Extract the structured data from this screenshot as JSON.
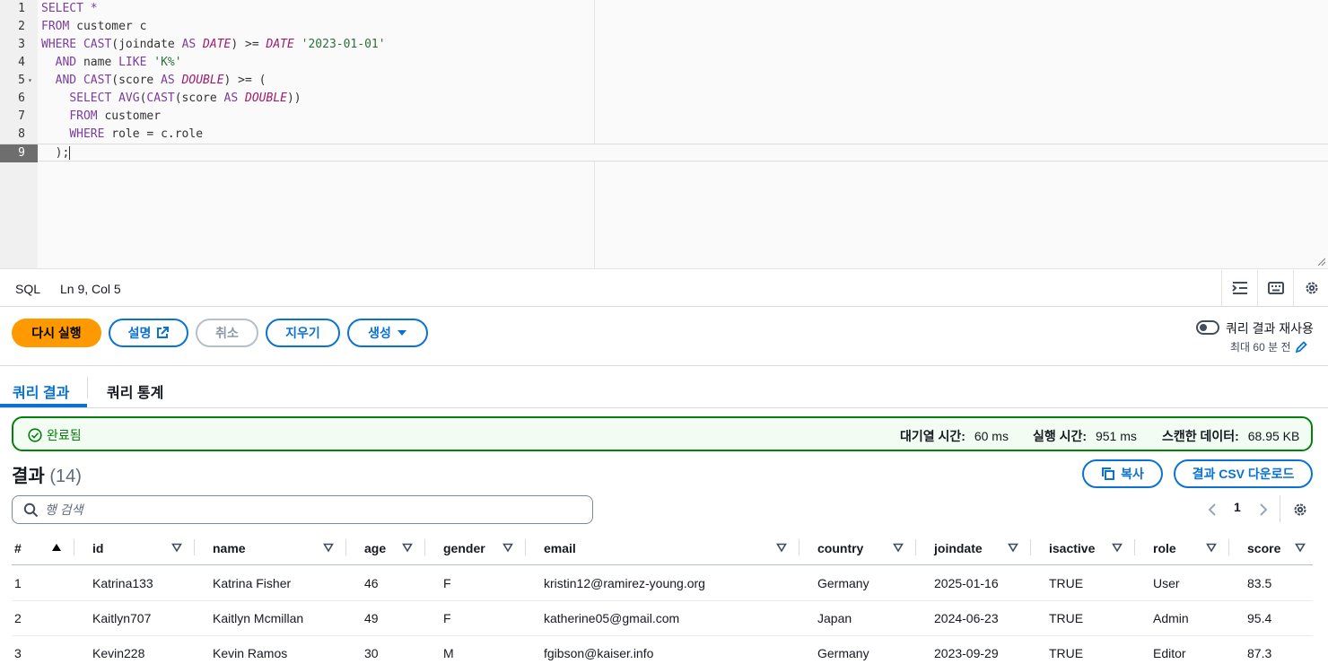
{
  "editor": {
    "lines": [
      {
        "n": "1",
        "parts": [
          {
            "t": "SELECT *",
            "c": "kw"
          }
        ]
      },
      {
        "n": "2",
        "parts": [
          {
            "t": "FROM",
            "c": "kw"
          },
          {
            "t": " customer c",
            "c": ""
          }
        ]
      },
      {
        "n": "3",
        "parts": [
          {
            "t": "WHERE",
            "c": "kw"
          },
          {
            "t": " ",
            "c": ""
          },
          {
            "t": "CAST",
            "c": "kw"
          },
          {
            "t": "(joindate ",
            "c": ""
          },
          {
            "t": "AS",
            "c": "kw"
          },
          {
            "t": " ",
            "c": ""
          },
          {
            "t": "DATE",
            "c": "ty"
          },
          {
            "t": ") >= ",
            "c": ""
          },
          {
            "t": "DATE",
            "c": "ty"
          },
          {
            "t": " ",
            "c": ""
          },
          {
            "t": "'2023-01-01'",
            "c": "st"
          }
        ]
      },
      {
        "n": "4",
        "parts": [
          {
            "t": "  ",
            "c": ""
          },
          {
            "t": "AND",
            "c": "kw"
          },
          {
            "t": " name ",
            "c": ""
          },
          {
            "t": "LIKE",
            "c": "kw"
          },
          {
            "t": " ",
            "c": ""
          },
          {
            "t": "'K%'",
            "c": "st"
          }
        ]
      },
      {
        "n": "5",
        "fold": true,
        "parts": [
          {
            "t": "  ",
            "c": ""
          },
          {
            "t": "AND",
            "c": "kw"
          },
          {
            "t": " ",
            "c": ""
          },
          {
            "t": "CAST",
            "c": "kw"
          },
          {
            "t": "(score ",
            "c": ""
          },
          {
            "t": "AS",
            "c": "kw"
          },
          {
            "t": " ",
            "c": ""
          },
          {
            "t": "DOUBLE",
            "c": "ty"
          },
          {
            "t": ") >= (",
            "c": ""
          }
        ]
      },
      {
        "n": "6",
        "parts": [
          {
            "t": "    ",
            "c": ""
          },
          {
            "t": "SELECT",
            "c": "kw"
          },
          {
            "t": " ",
            "c": ""
          },
          {
            "t": "AVG",
            "c": "kw"
          },
          {
            "t": "(",
            "c": ""
          },
          {
            "t": "CAST",
            "c": "kw"
          },
          {
            "t": "(score ",
            "c": ""
          },
          {
            "t": "AS",
            "c": "kw"
          },
          {
            "t": " ",
            "c": ""
          },
          {
            "t": "DOUBLE",
            "c": "ty"
          },
          {
            "t": "))",
            "c": ""
          }
        ]
      },
      {
        "n": "7",
        "parts": [
          {
            "t": "    ",
            "c": ""
          },
          {
            "t": "FROM",
            "c": "kw"
          },
          {
            "t": " customer",
            "c": ""
          }
        ]
      },
      {
        "n": "8",
        "parts": [
          {
            "t": "    ",
            "c": ""
          },
          {
            "t": "WHERE",
            "c": "kw"
          },
          {
            "t": " role = c.role",
            "c": ""
          }
        ]
      },
      {
        "n": "9",
        "active": true,
        "parts": [
          {
            "t": "  );",
            "c": ""
          }
        ]
      }
    ]
  },
  "statusbar": {
    "language": "SQL",
    "position": "Ln 9, Col 5"
  },
  "actions": {
    "rerun": "다시 실행",
    "explain": "설명",
    "cancel": "취소",
    "clear": "지우기",
    "generate": "생성"
  },
  "reuse": {
    "label": "쿼리 결과 재사용",
    "sub": "최대 60 분 전"
  },
  "tabs": {
    "results": "쿼리 결과",
    "stats": "쿼리 통계"
  },
  "alert": {
    "status": "완료됨",
    "queue_label": "대기열 시간:",
    "queue_value": "60 ms",
    "exec_label": "실행 시간:",
    "exec_value": "951 ms",
    "scan_label": "스캔한 데이터:",
    "scan_value": "68.95 KB"
  },
  "results": {
    "title": "결과",
    "count": "(14)",
    "copy": "복사",
    "download": "결과 CSV 다운로드",
    "search_placeholder": "행 검색",
    "page": "1"
  },
  "table": {
    "columns": [
      "#",
      "id",
      "name",
      "age",
      "gender",
      "email",
      "country",
      "joindate",
      "isactive",
      "role",
      "score"
    ],
    "rows": [
      [
        "1",
        "Katrina133",
        "Katrina Fisher",
        "46",
        "F",
        "kristin12@ramirez-young.org",
        "Germany",
        "2025-01-16",
        "TRUE",
        "User",
        "83.5"
      ],
      [
        "2",
        "Kaitlyn707",
        "Kaitlyn Mcmillan",
        "49",
        "F",
        "katherine05@gmail.com",
        "Japan",
        "2024-06-23",
        "TRUE",
        "Admin",
        "95.4"
      ],
      [
        "3",
        "Kevin228",
        "Kevin Ramos",
        "30",
        "M",
        "fgibson@kaiser.info",
        "Germany",
        "2023-09-29",
        "TRUE",
        "Editor",
        "87.3"
      ]
    ]
  },
  "colors": {
    "accent": "#0972d3",
    "primary": "#ff9900",
    "success": "#037f0c"
  }
}
